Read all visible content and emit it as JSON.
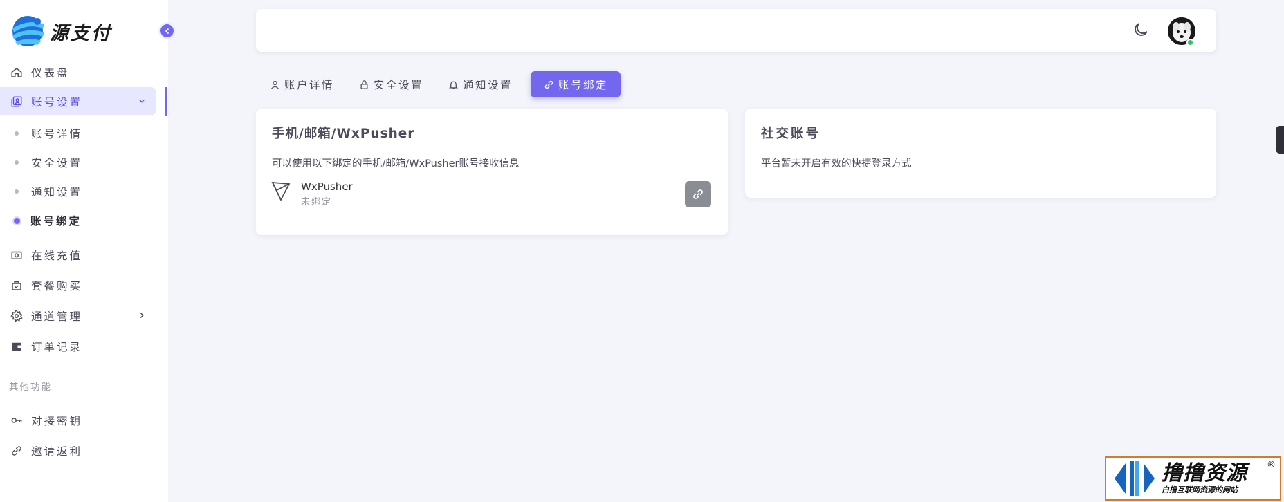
{
  "brand": {
    "name": "源支付"
  },
  "sidebar": {
    "items": [
      {
        "label": "仪表盘",
        "icon": "home-icon"
      },
      {
        "label": "账号设置",
        "icon": "account-settings-icon"
      },
      {
        "label": "在线充值",
        "icon": "recharge-icon"
      },
      {
        "label": "套餐购买",
        "icon": "package-icon"
      },
      {
        "label": "通道管理",
        "icon": "gear-icon"
      },
      {
        "label": "订单记录",
        "icon": "wallet-icon"
      }
    ],
    "sub_items": [
      "账号详情",
      "安全设置",
      "通知设置",
      "账号绑定"
    ],
    "section_label": "其他功能",
    "extra_items": [
      {
        "label": "对接密钥",
        "icon": "key-icon"
      },
      {
        "label": "邀请返利",
        "icon": "link-icon"
      }
    ]
  },
  "tabs": [
    {
      "label": "账户详情",
      "icon": "user-icon"
    },
    {
      "label": "安全设置",
      "icon": "lock-icon"
    },
    {
      "label": "通知设置",
      "icon": "bell-icon"
    },
    {
      "label": "账号绑定",
      "icon": "link-icon"
    }
  ],
  "binding_card": {
    "title": "手机/邮箱/WxPusher",
    "description": "可以使用以下绑定的手机/邮箱/WxPusher账号接收信息",
    "service_name": "WxPusher",
    "service_status": "未绑定"
  },
  "social_card": {
    "title": "社交账号",
    "description": "平台暂未开启有效的快捷登录方式"
  },
  "watermark": {
    "title": "撸撸资源",
    "subtitle": "白撸互联网资源的网站",
    "reg_mark": "®"
  },
  "colors": {
    "primary": "#7367f0",
    "active_bg": "#e7e7ff",
    "page_bg": "#f4f5fa",
    "online": "#28c76f",
    "link_button": "#8a8d93"
  }
}
